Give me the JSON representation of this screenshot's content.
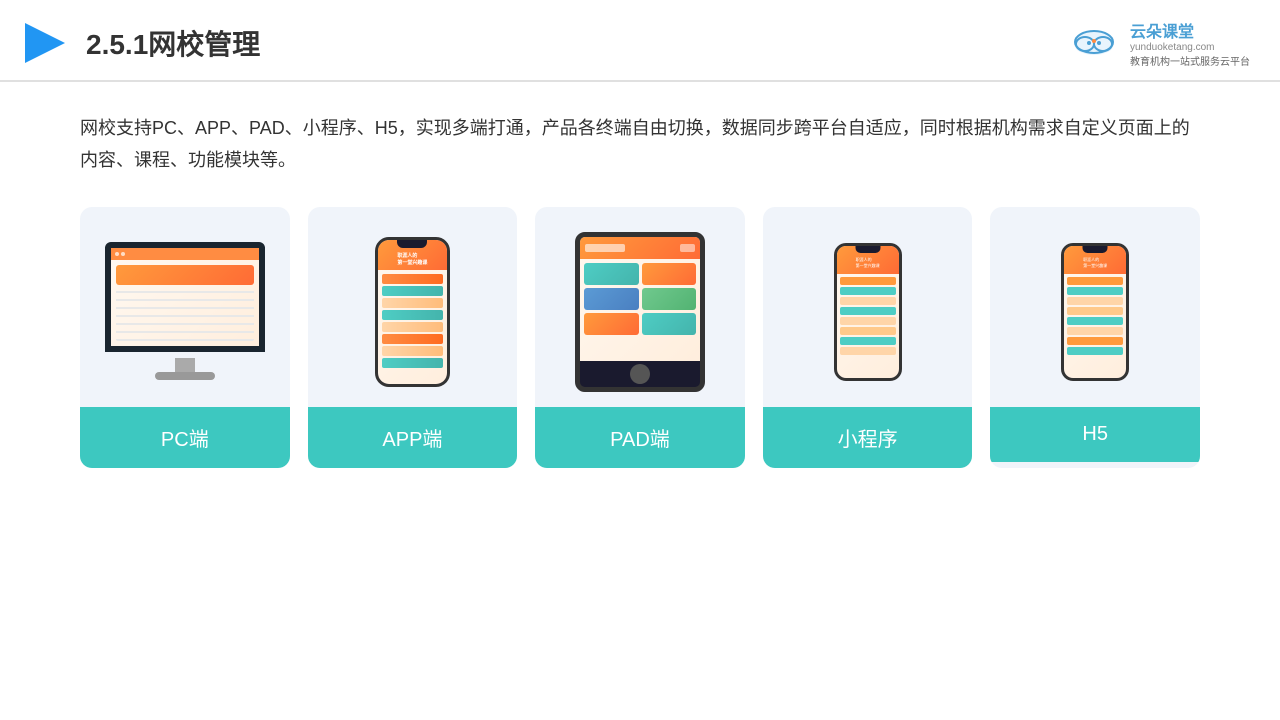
{
  "header": {
    "title": "2.5.1网校管理",
    "logo_brand": "云朵课堂",
    "logo_url": "yunduoketang.com",
    "logo_slogan": "教育机构一站式服务云平台"
  },
  "description": {
    "text": "网校支持PC、APP、PAD、小程序、H5，实现多端打通，产品各终端自由切换，数据同步跨平台自适应，同时根据机构需求自定义页面上的内容、课程、功能模块等。"
  },
  "cards": [
    {
      "id": "pc",
      "label": "PC端"
    },
    {
      "id": "app",
      "label": "APP端"
    },
    {
      "id": "pad",
      "label": "PAD端"
    },
    {
      "id": "miniprogram",
      "label": "小程序"
    },
    {
      "id": "h5",
      "label": "H5"
    }
  ],
  "colors": {
    "teal": "#3dc8c0",
    "accent_orange": "#ff9a3c",
    "bg_card": "#eef2f9",
    "header_border": "#e0e0e0"
  }
}
